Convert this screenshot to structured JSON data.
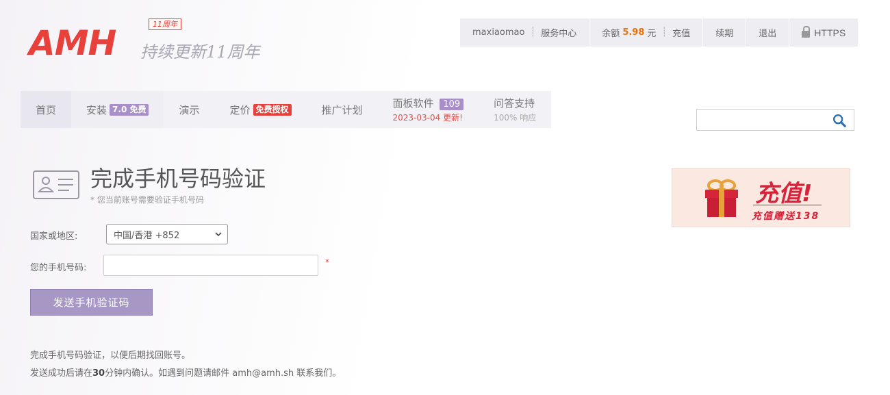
{
  "logo": {
    "brand": "AMH",
    "badge": "11周年",
    "slogan": "持续更新11周年"
  },
  "topbar": {
    "username": "maxiaomao",
    "service_center": "服务中心",
    "balance_label": "余额",
    "balance_value": "5.98",
    "balance_unit": "元",
    "recharge": "充值",
    "renew": "续期",
    "logout": "退出",
    "https": "HTTPS"
  },
  "nav": {
    "home": "首页",
    "install": "安装",
    "install_tag": "7.0 免费",
    "demo": "演示",
    "pricing": "定价",
    "pricing_tag": "免费授权",
    "affiliate": "推广计划",
    "panel_software": "面板软件",
    "panel_count": "109",
    "panel_updated": "2023-03-04 更新!",
    "support": "问答支持",
    "support_sub": "100% 响应"
  },
  "search": {
    "placeholder": "",
    "icon": "search-icon"
  },
  "promo": {
    "title": "充值!",
    "subtitle": "充值赠送138"
  },
  "page": {
    "title": "完成手机号码验证",
    "subtitle": "* 您当前账号需要验证手机号码"
  },
  "form": {
    "country_label": "国家或地区:",
    "country_value": "中国/香港 +852",
    "phone_label": "您的手机号码:",
    "phone_value": "",
    "required_mark": "*",
    "send_button": "发送手机验证码"
  },
  "notes": {
    "line1": "完成手机号码验证，以便后期找回账号。",
    "line2_pre": "发送成功后请在",
    "line2_minutes": "30",
    "line2_post": "分钟内确认。如遇到问题请邮件 amh@amh.sh 联系我们。"
  },
  "colors": {
    "brand_red": "#e8403a",
    "accent_purple": "#a797c4",
    "balance_orange": "#e8710a"
  }
}
